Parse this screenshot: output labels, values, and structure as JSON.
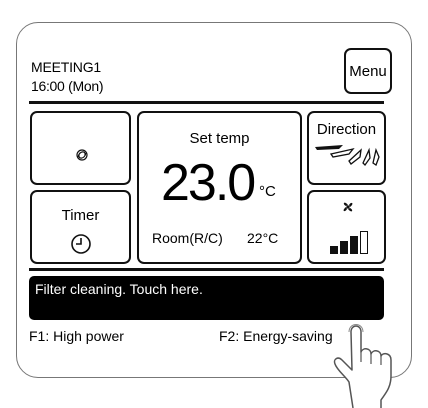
{
  "header": {
    "room_name": "MEETING1",
    "clock": "16:00 (Mon)",
    "menu_label": "Menu"
  },
  "panel": {
    "fan_mode_icon": "swirl-icon",
    "set_temp_label": "Set temp",
    "set_temp_value": "23.0",
    "temp_unit": "°C",
    "room_temp_label": "Room(R/C)",
    "room_temp_value": "22°C",
    "direction_label": "Direction",
    "direction_icon": "louver-direction-icon",
    "timer_label": "Timer",
    "timer_icon": "clock-icon",
    "fan_speed_icon": "fan-icon",
    "fan_speed_level": 3,
    "fan_speed_max": 4
  },
  "message": {
    "text": "Filter cleaning. Touch here."
  },
  "function_keys": {
    "f1": "F1: High power",
    "f2": "F2: Energy-saving"
  },
  "colors": {
    "frame": "#777777",
    "ink": "#111111",
    "message_bg": "#000000",
    "message_fg": "#ffffff"
  }
}
